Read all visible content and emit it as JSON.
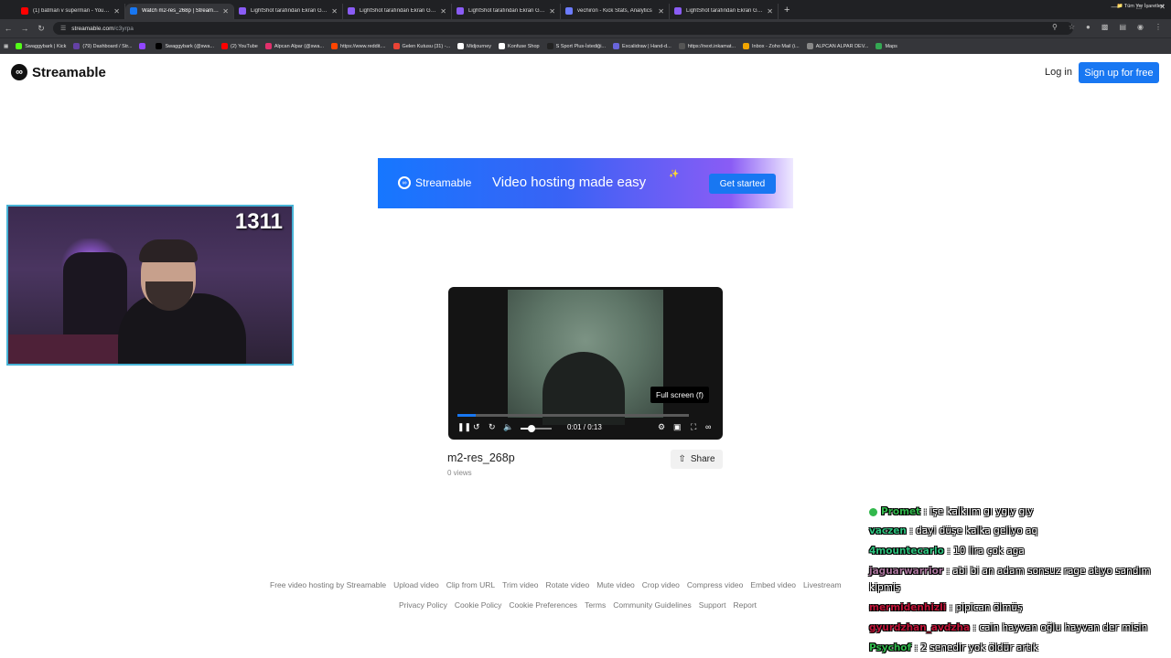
{
  "browser": {
    "tabs": [
      {
        "title": "(1) batman v superman - YouTube",
        "color": "#ff0000",
        "active": false
      },
      {
        "title": "Watch m2-res_268p | Streamable",
        "color": "#1877f2",
        "active": true
      },
      {
        "title": "LightShot tarafından Ekran Görüntüsü",
        "color": "#8a5cf5",
        "active": false
      },
      {
        "title": "LightShot tarafından Ekran Görüntüsü",
        "color": "#8a5cf5",
        "active": false
      },
      {
        "title": "LightShot tarafından Ekran Görüntüsü",
        "color": "#8a5cf5",
        "active": false
      },
      {
        "title": "vechiron - Kick Stats, Analytics",
        "color": "#6c7cff",
        "active": false
      },
      {
        "title": "LightShot tarafından Ekran Görüntüsü",
        "color": "#8a5cf5",
        "active": false
      }
    ],
    "new_tab_icon": "+",
    "url_domain": "streamable.com",
    "url_path": "/c3yrpa",
    "bookmarks": [
      {
        "label": "Swaggybark | Kick",
        "color": "#53fc18"
      },
      {
        "label": "(79) Dashboard / Str...",
        "color": "#6441a5"
      },
      {
        "label": "",
        "color": "#9146ff"
      },
      {
        "label": "Swaggybark (@swa...",
        "color": "#000000"
      },
      {
        "label": "(2) YouTube",
        "color": "#ff0000"
      },
      {
        "label": "Alpcan Alpar (@swa...",
        "color": "#e1306c"
      },
      {
        "label": "https://www.reddit....",
        "color": "#ff4500"
      },
      {
        "label": "Gelen Kutusu (31) -...",
        "color": "#ea4335"
      },
      {
        "label": "Midjourney",
        "color": "#ffffff"
      },
      {
        "label": "Konfuse Shop",
        "color": "#ffffff"
      },
      {
        "label": "S Sport Plus-İstediği...",
        "color": "#222222"
      },
      {
        "label": "Excalidraw | Hand-d...",
        "color": "#6965db"
      },
      {
        "label": "https://next.inkamat...",
        "color": "#555555"
      },
      {
        "label": "Inbox - Zoho Mail (i...",
        "color": "#f0a500"
      },
      {
        "label": "ALPCAN ALPAR DEV...",
        "color": "#888888"
      },
      {
        "label": "Maps",
        "color": "#34a853"
      }
    ],
    "bookmarks_right": "Tüm Yer İşaretleri"
  },
  "site": {
    "logo_text": "Streamable",
    "login_label": "Log in",
    "signup_label": "Sign up for free",
    "accent": "#1877f2"
  },
  "banner": {
    "logo_text": "Streamable",
    "tagline": "Video hosting made easy",
    "cta_label": "Get started"
  },
  "webcam": {
    "counter": "1311"
  },
  "player": {
    "tooltip": "Full screen (f)",
    "time": "0:01 / 0:13",
    "progress_fraction": 0.08,
    "volume_fraction": 0.35
  },
  "video": {
    "title": "m2-res_268p",
    "views": "0 views",
    "share_label": "Share"
  },
  "footer": {
    "row1": [
      "Free video hosting by Streamable",
      "Upload video",
      "Clip from URL",
      "Trim video",
      "Rotate video",
      "Mute video",
      "Crop video",
      "Compress video",
      "Embed video",
      "Livestream"
    ],
    "row2": [
      "Privacy Policy",
      "Cookie Policy",
      "Cookie Preferences",
      "Terms",
      "Community Guidelines",
      "Support",
      "Report"
    ]
  },
  "chat": [
    {
      "user": "Promet",
      "text": ": işe kalkıım gı ygıy gıy",
      "color": "#32b84c",
      "badge": true
    },
    {
      "user": "vaczen",
      "text": ": dayi düşe kalka geliyo aq",
      "color": "#2ec27e",
      "badge": false
    },
    {
      "user": "4mountecarlo",
      "text": ": 10 lira çok aga",
      "color": "#2ec27e",
      "badge": false
    },
    {
      "user": "jaguarwarrior",
      "text": ": abi bi an adam sonsuz rage atıyo sandım",
      "color": "#a9749c",
      "badge": false
    },
    {
      "user": "",
      "text": "kipmiş",
      "color": "#ffffff",
      "badge": false
    },
    {
      "user": "mermidenhizli",
      "text": ": pipican ölmüş",
      "color": "#c01438",
      "badge": false
    },
    {
      "user": "gyurdzhan_avdzha",
      "text": ": cain hayvan oğlu hayvan der misin",
      "color": "#c01438",
      "badge": false
    },
    {
      "user": "Psychof",
      "text": ": 2 senedir yok öldür artık",
      "color": "#32b84c",
      "badge": false
    }
  ]
}
